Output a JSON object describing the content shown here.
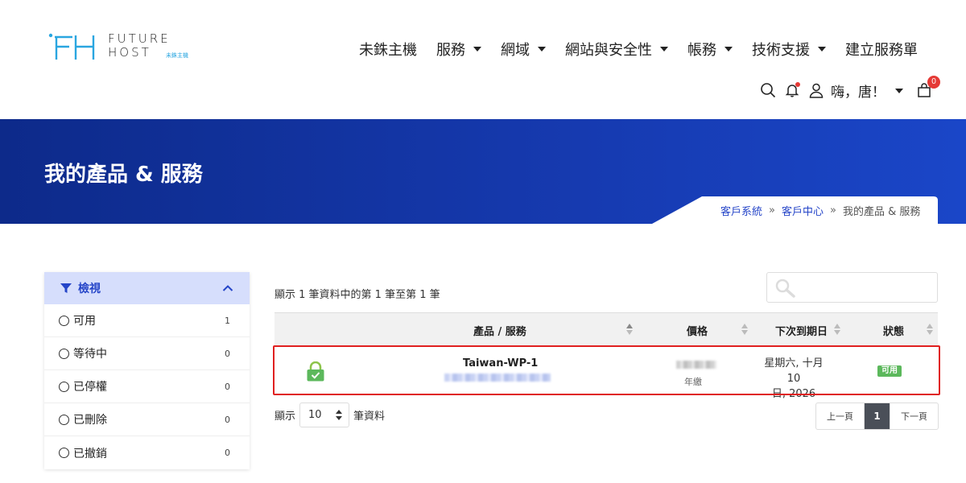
{
  "header": {
    "logo": {
      "line1": "FUTURE",
      "line2": "HOST",
      "sub": "未銖主機",
      "icon": "fh-logo-icon"
    },
    "nav": [
      {
        "label": "未銖主機",
        "dropdown": false
      },
      {
        "label": "服務",
        "dropdown": true
      },
      {
        "label": "網域",
        "dropdown": true
      },
      {
        "label": "網站與安全性",
        "dropdown": true
      },
      {
        "label": "帳務",
        "dropdown": true
      },
      {
        "label": "技術支援",
        "dropdown": true
      },
      {
        "label": "建立服務單",
        "dropdown": false
      }
    ],
    "greeting": "嗨，唐！",
    "cart_count": "0",
    "icons": [
      "search-icon",
      "bell-icon",
      "user-icon",
      "cart-icon"
    ]
  },
  "banner": {
    "title": "我的產品 & 服務",
    "breadcrumb": {
      "items": [
        "客戶系統",
        "客戶中心"
      ],
      "separator": "»",
      "current": "我的產品 & 服務"
    }
  },
  "sidebar": {
    "title": "檢視",
    "items": [
      {
        "label": "可用",
        "count": "1"
      },
      {
        "label": "等待中",
        "count": "0"
      },
      {
        "label": "已停權",
        "count": "0"
      },
      {
        "label": "已刪除",
        "count": "0"
      },
      {
        "label": "已撤銷",
        "count": "0"
      }
    ]
  },
  "table": {
    "info": "顯示 1 筆資料中的第 1 筆至第 1 筆",
    "search_placeholder": "",
    "columns": [
      "產品 / 服務",
      "價格",
      "下次到期日",
      "狀態"
    ],
    "rows": [
      {
        "product": "Taiwan-WP-1",
        "billing_cycle": "年繳",
        "due_line1": "星期六, 十月 10",
        "due_line2": "日, 2026",
        "status": "可用"
      }
    ],
    "length": {
      "prefix": "顯示",
      "value": "10",
      "suffix": "筆資料"
    },
    "pagination": {
      "prev": "上一頁",
      "current": "1",
      "next": "下一頁"
    }
  },
  "colors": {
    "accent": "#2545c8",
    "banner": "#163ab0",
    "status_active": "#5cb85c",
    "highlight": "#e02020",
    "badge": "#e53935"
  }
}
